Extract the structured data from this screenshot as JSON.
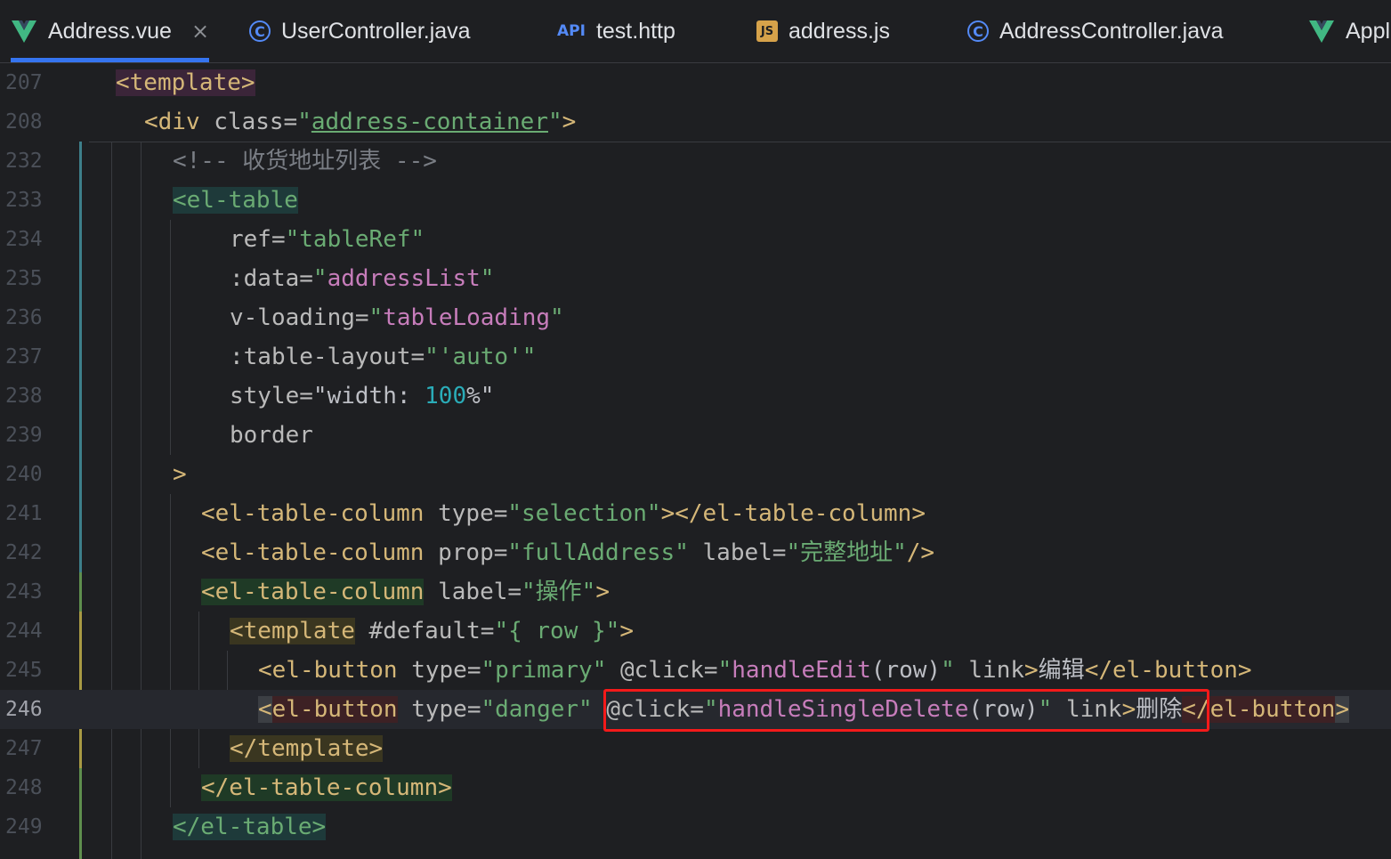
{
  "tabs": [
    {
      "label": "Address.vue",
      "icon": "vue-icon",
      "active": true
    },
    {
      "label": "UserController.java",
      "icon": "class-icon"
    },
    {
      "label": "test.http",
      "icon": "api-icon",
      "icon_text": "API"
    },
    {
      "label": "address.js",
      "icon": "js-icon",
      "icon_text": "JS"
    },
    {
      "label": "AddressController.java",
      "icon": "class-icon"
    },
    {
      "label": "Appl",
      "icon": "vue-icon"
    }
  ],
  "close_glyph": "×",
  "colors": {
    "accent": "#3574f0",
    "tag": "#d5b778",
    "string": "#6aab73",
    "comment": "#7a7e85",
    "highlight_box": "#f41a1a"
  },
  "lines": [
    {
      "num": "207",
      "tokens": [
        "<template>"
      ]
    },
    {
      "num": "208",
      "tokens": [
        "<div",
        " class=",
        "\"",
        "address-container",
        "\"",
        ">"
      ]
    },
    {
      "num": "232",
      "tokens": [
        "<!-- 收货地址列表 -->"
      ]
    },
    {
      "num": "233",
      "tokens": [
        "<el-table"
      ]
    },
    {
      "num": "234",
      "tokens": [
        "ref=",
        "\"tableRef\""
      ]
    },
    {
      "num": "235",
      "tokens": [
        ":data=",
        "\"",
        "addressList",
        "\""
      ]
    },
    {
      "num": "236",
      "tokens": [
        "v-loading=",
        "\"",
        "tableLoading",
        "\""
      ]
    },
    {
      "num": "237",
      "tokens": [
        ":table-layout=",
        "\"'auto'\""
      ]
    },
    {
      "num": "238",
      "tokens": [
        "style=",
        "\"width: ",
        "100",
        "%\""
      ]
    },
    {
      "num": "239",
      "tokens": [
        "border"
      ]
    },
    {
      "num": "240",
      "tokens": [
        ">"
      ]
    },
    {
      "num": "241",
      "tokens": [
        "<el-table-column",
        " type=",
        "\"selection\"",
        "></el-table-column>"
      ]
    },
    {
      "num": "242",
      "tokens": [
        "<el-table-column",
        " prop=",
        "\"fullAddress\"",
        " label=",
        "\"完整地址\"",
        "/>"
      ]
    },
    {
      "num": "243",
      "tokens": [
        "<el-table-column",
        " label=",
        "\"操作\"",
        ">"
      ]
    },
    {
      "num": "244",
      "tokens": [
        "<template",
        " #default=",
        "\"{ row }\"",
        ">"
      ]
    },
    {
      "num": "245",
      "tokens": [
        "<el-button",
        " type=",
        "\"primary\"",
        " @click=",
        "\"",
        "handleEdit",
        "(row)",
        "\"",
        " link",
        ">",
        "编辑",
        "</el-button>"
      ]
    },
    {
      "num": "246",
      "tokens": [
        "<",
        "el-button",
        " type=",
        "\"danger\"",
        " @click=",
        "\"",
        "handleSingleDelete",
        "(row)",
        "\"",
        " link",
        ">",
        "删除",
        "</",
        "el-button",
        ">"
      ]
    },
    {
      "num": "247",
      "tokens": [
        "</template>"
      ]
    },
    {
      "num": "248",
      "tokens": [
        "</el-table-column>"
      ]
    },
    {
      "num": "249",
      "tokens": [
        "</el-table>"
      ]
    }
  ]
}
